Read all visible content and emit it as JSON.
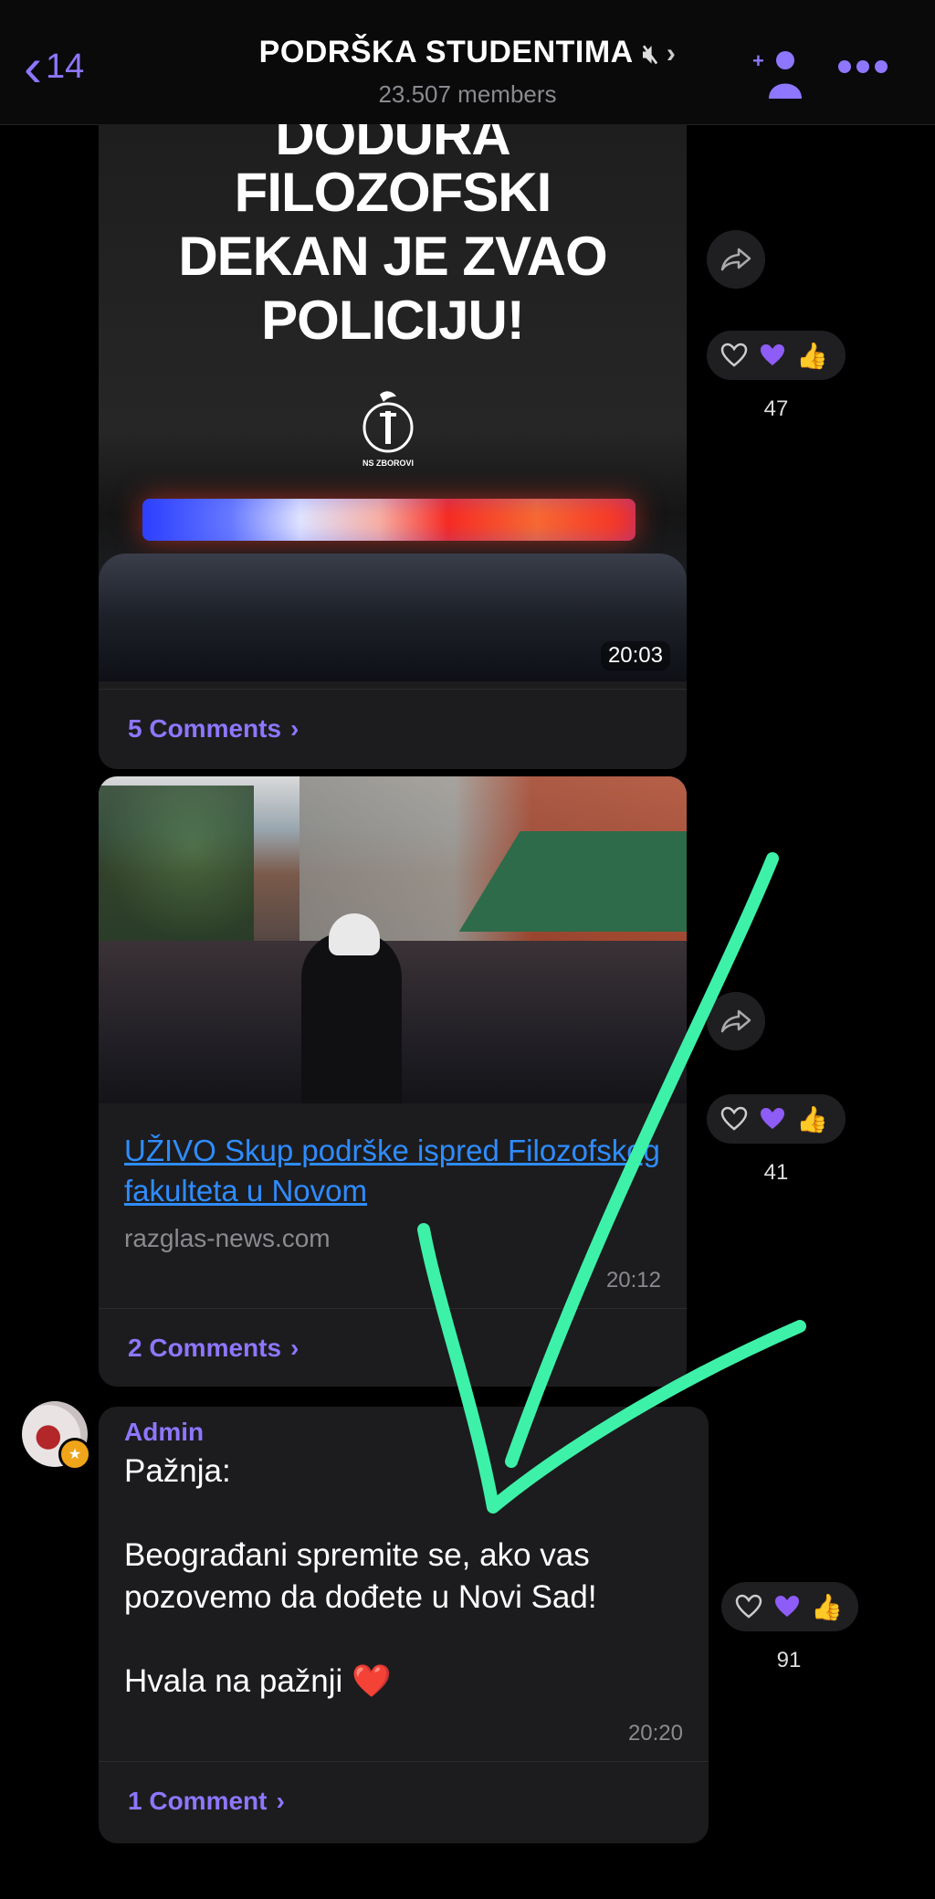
{
  "header": {
    "back_count": "14",
    "title": "PODRŠKA STUDENTIMA",
    "members": "23.507 members"
  },
  "post1": {
    "lines": [
      "DODURA",
      "FILOZOFSKI",
      "DEKAN JE ZVAO",
      "POLICIJU!"
    ],
    "logo_text": "NS ZBOROVI",
    "time": "20:03",
    "comments": "5 Comments",
    "reactions_count": "47"
  },
  "post2": {
    "link": "UŽIVO Skup podrške ispred Filozofskog fakulteta u Novom",
    "domain": "razglas-news.com",
    "time": "20:12",
    "comments": "2 Comments",
    "reactions_count": "41"
  },
  "post3": {
    "sender": "Admin",
    "text1": "Pažnja:",
    "text2": "Beograđani spremite se, ako vas pozovemo da dođete u Novi Sad!",
    "text3": "Hvala na pažnji ❤️",
    "time": "20:20",
    "comments": "1 Comment",
    "reactions_count": "91"
  },
  "colors": {
    "accent": "#8e76ff",
    "link": "#2f8cff",
    "annotation_arrow": "#3df2a8"
  }
}
